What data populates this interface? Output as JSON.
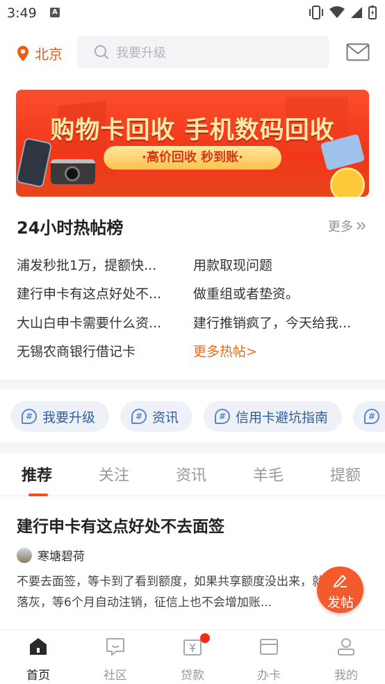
{
  "status_bar": {
    "time": "3:49",
    "notification_letter": "A"
  },
  "header": {
    "city": "北京",
    "search_placeholder": "我要升级"
  },
  "banner": {
    "title": "购物卡回收 手机数码回收",
    "subtitle": "·高价回收 秒到账·"
  },
  "hot": {
    "title": "24小时热帖榜",
    "more_label": "更多",
    "items": [
      "浦发秒批1万，提额快...",
      "用款取现问题",
      "建行申卡有这点好处不...",
      "做重组或者垫资。",
      "大山白申卡需要什么资...",
      "建行推销疯了，今天给我...",
      "无锡农商银行借记卡",
      "更多热帖>"
    ]
  },
  "topics": [
    {
      "label": "我要升级"
    },
    {
      "label": "资讯"
    },
    {
      "label": "信用卡避坑指南"
    },
    {
      "label": ""
    }
  ],
  "tabs": [
    "推荐",
    "关注",
    "资讯",
    "羊毛",
    "提额"
  ],
  "post": {
    "title": "建行申卡有这点好处不去面签",
    "author": "寒塘碧荷",
    "body": "不要去面签，等卡到了看到额度，如果共享额度没出来，就扔抽屉落灰，等6个月自动注销，征信上也不会增加账..."
  },
  "fab": {
    "label": "发帖"
  },
  "bottom_nav": [
    {
      "label": "首页",
      "active": true
    },
    {
      "label": "社区",
      "active": false
    },
    {
      "label": "贷款",
      "active": false,
      "badge": true
    },
    {
      "label": "办卡",
      "active": false
    },
    {
      "label": "我的",
      "active": false
    }
  ],
  "colors": {
    "accent": "#f05a14",
    "fab": "#f35a2c",
    "topic_text": "#2e5d9f"
  }
}
